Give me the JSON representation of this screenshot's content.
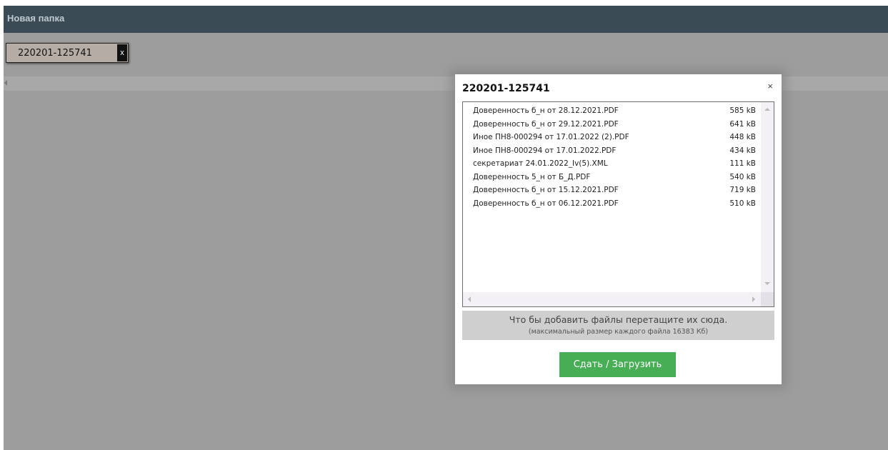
{
  "header": {
    "title": "Новая папка"
  },
  "tab": {
    "label": "220201-125741",
    "close_label": "x"
  },
  "modal": {
    "title": "220201-125741",
    "close_label": "×",
    "files": [
      {
        "name": "Доверенность б_н от 28.12.2021.PDF",
        "size": "585 kB"
      },
      {
        "name": "Доверенность б_н от 29.12.2021.PDF",
        "size": "641 kB"
      },
      {
        "name": "Иное ПН8-000294 от 17.01.2022 (2).PDF",
        "size": "448 kB"
      },
      {
        "name": "Иное ПН8-000294 от 17.01.2022.PDF",
        "size": "434 kB"
      },
      {
        "name": "секретариат 24.01.2022_Iv(5).XML",
        "size": "111 kB"
      },
      {
        "name": "Доверенность 5_н от Б_Д.PDF",
        "size": "540 kB"
      },
      {
        "name": "Доверенность б_н от 15.12.2021.PDF",
        "size": "719 kB"
      },
      {
        "name": "Доверенность б_н от 06.12.2021.PDF",
        "size": "510 kB"
      }
    ],
    "drop_zone": {
      "main_text": "Что бы добавить файлы перетащите их сюда.",
      "sub_text": "(максимальный размер каждого файла 16383 Кб)"
    },
    "upload_button_label": "Сдать / Загрузить"
  },
  "colors": {
    "header_bg": "#3a4b55",
    "overlay_bg": "#9d9d9d",
    "button_green": "#47ae55"
  },
  "icons": {
    "tab_close": "close-icon",
    "modal_close": "close-icon",
    "scroll_up": "arrow-up-icon",
    "scroll_down": "arrow-down-icon",
    "scroll_left": "arrow-left-icon",
    "scroll_right": "arrow-right-icon"
  }
}
